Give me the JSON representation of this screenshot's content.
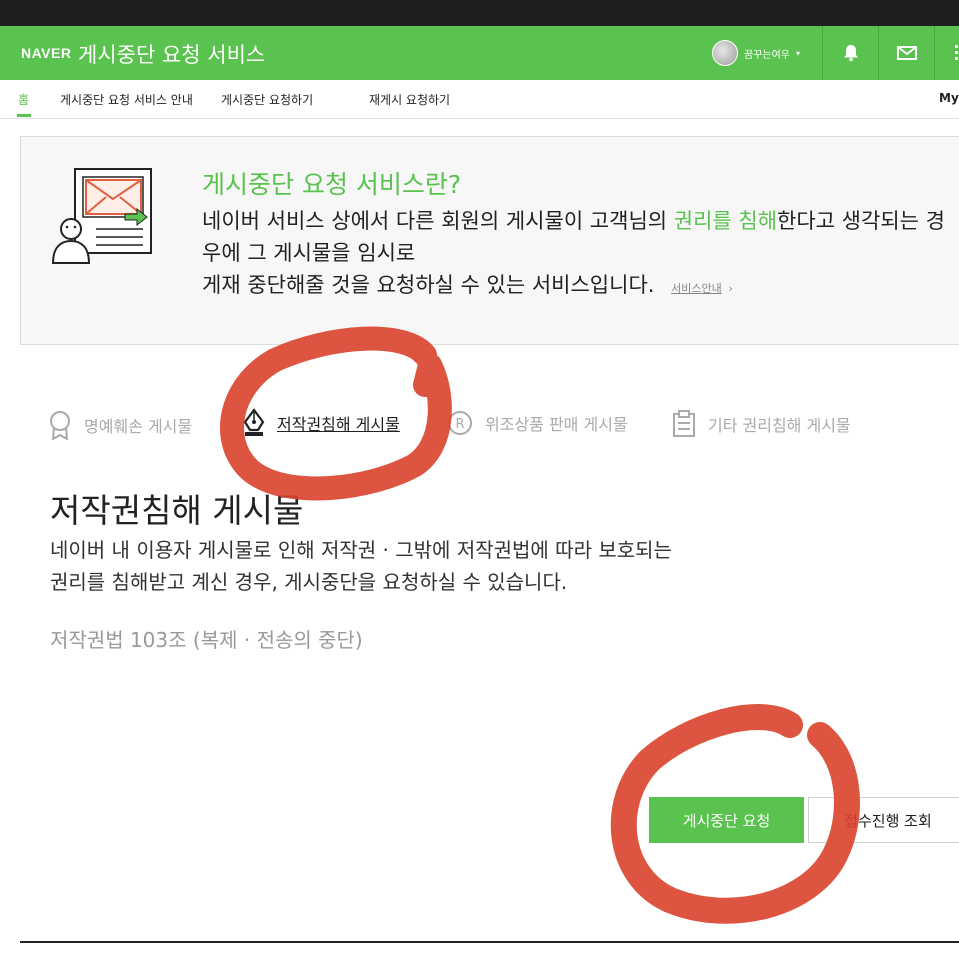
{
  "header": {
    "logo": "NAVER",
    "title": "게시중단 요청 서비스",
    "username": "꿈꾸는여우",
    "caret": "▾",
    "colors": {
      "brand": "#5ac24f",
      "topbar": "#1f1f1f"
    },
    "icons": [
      "bell-icon",
      "mail-icon",
      "apps-grid-icon"
    ]
  },
  "nav": {
    "items": [
      {
        "label": "홈",
        "active": true
      },
      {
        "label": "게시중단 요청 서비스 안내"
      },
      {
        "label": "게시중단 요청하기"
      },
      {
        "label": "재게시 요청하기"
      },
      {
        "label": "My"
      }
    ]
  },
  "intro": {
    "icon": "document-person-icon",
    "title": "게시중단 요청 서비스란?",
    "text_before": "네이버 서비스 상에서 다른 회원의 게시물이 고객님의 ",
    "highlight": "권리를 침해",
    "text_after": "한다고 생각되는 경우에 그 게시물을 임시로",
    "text_line3": "게재 중단해줄 것을 요청하실 수 있는 서비스입니다.",
    "guide_link": "서비스안내",
    "guide_arrow": "›"
  },
  "categories": [
    {
      "label": "명예훼손 게시물",
      "icon": "medal-icon"
    },
    {
      "label": "저작권침해 게시물",
      "icon": "pen-nib-icon",
      "active": true
    },
    {
      "label": "위조상품 판매 게시물",
      "icon": "registered-icon"
    },
    {
      "label": "기타 권리침해 게시물",
      "icon": "clipboard-icon"
    }
  ],
  "section": {
    "title": "저작권침해 게시물",
    "desc_line1": "네이버 내 이용자 게시물로 인해 저작권 · 그밖에 저작권법에 따라 보호되는",
    "desc_line2": "권리를 침해받고 계신 경우, 게시중단을 요청하실 수 있습니다.",
    "law": "저작권법 103조 (복제 · 전송의 중단)"
  },
  "actions": {
    "primary": "게시중단 요청",
    "secondary": "접수진행 조회"
  },
  "annotation_color": "#d9412b"
}
